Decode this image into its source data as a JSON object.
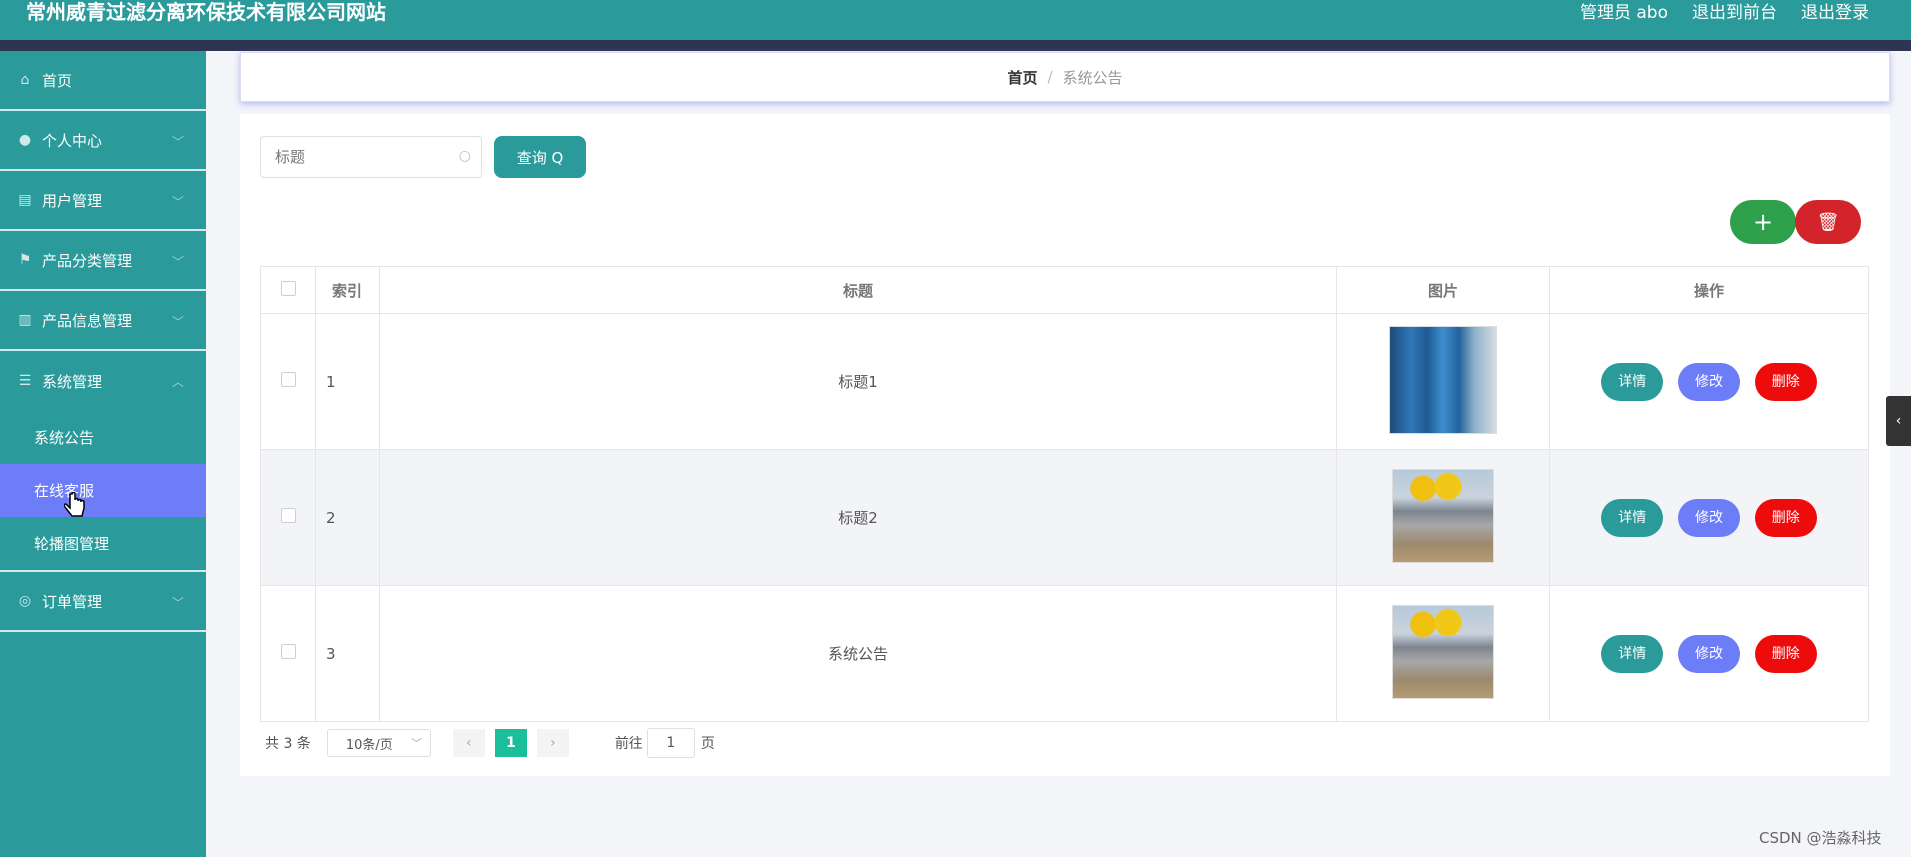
{
  "header": {
    "title": "常州威青过滤分离环保技术有限公司网站",
    "user": "管理员 abo",
    "to_front": "退出到前台",
    "logout": "退出登录"
  },
  "sidebar": {
    "items": [
      {
        "label": "首页",
        "icon": "home-icon"
      },
      {
        "label": "个人中心",
        "icon": "user-icon"
      },
      {
        "label": "用户管理",
        "icon": "clipboard-icon"
      },
      {
        "label": "产品分类管理",
        "icon": "flag-icon"
      },
      {
        "label": "产品信息管理",
        "icon": "chart-icon"
      },
      {
        "label": "系统管理",
        "icon": "list-icon"
      },
      {
        "label": "订单管理",
        "icon": "globe-icon"
      }
    ],
    "sub_items": [
      {
        "label": "系统公告"
      },
      {
        "label": "在线客服",
        "active": true
      },
      {
        "label": "轮播图管理"
      }
    ]
  },
  "breadcrumb": {
    "home": "首页",
    "separator": "/",
    "current": "系统公告"
  },
  "search": {
    "placeholder": "标题",
    "button": "查询"
  },
  "table": {
    "headers": [
      "索引",
      "标题",
      "图片",
      "操作"
    ],
    "rows": [
      {
        "index": "1",
        "title": "标题1",
        "image": "blue-filter-tanks"
      },
      {
        "index": "2",
        "title": "标题2",
        "image": "industrial-separator"
      },
      {
        "index": "3",
        "title": "系统公告",
        "image": "industrial-separator"
      }
    ],
    "ops": {
      "detail": "详情",
      "edit": "修改",
      "remove": "删除"
    }
  },
  "pagination": {
    "total": "共 3 条",
    "page_size": "10条/页",
    "current_page": "1",
    "goto_label": "前往",
    "goto_value": "1",
    "page_unit": "页"
  },
  "watermark": "CSDN @浩淼科技",
  "colors": {
    "primary": "#2b9a9b",
    "accent": "#6d7df7",
    "danger": "#ee0b0b",
    "success": "#2e9f4b"
  }
}
